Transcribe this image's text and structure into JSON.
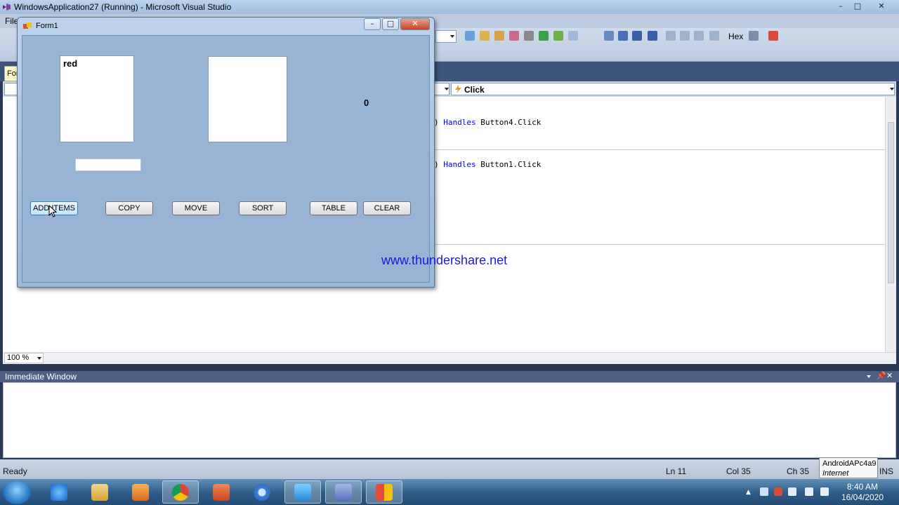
{
  "vs": {
    "title": "WindowsApplication27 (Running) - Microsoft Visual Studio",
    "menu_file": "File",
    "toolbar_hex": "Hex",
    "doc_tab_label": "For",
    "nav_event": "Click",
    "code_lines": [
      {
        "keyword": "Handles",
        "target": "Button4.Click"
      },
      {
        "keyword": "Handles",
        "target": "Button1.Click"
      }
    ],
    "zoom": "100 %",
    "immediate_window_title": "Immediate Window",
    "status": {
      "ready": "Ready",
      "ln": "Ln 11",
      "col": "Col 35",
      "ch": "Ch 35",
      "ins": "INS"
    },
    "tooltip": {
      "network": "AndroidAPc4a9",
      "access": "Internet access"
    },
    "clock": {
      "time": "8:40 AM",
      "date": "16/04/2020"
    }
  },
  "form1": {
    "title": "Form1",
    "listbox1_items": [
      "red"
    ],
    "count_label": "0",
    "textbox_value": "",
    "buttons": {
      "add_items": "ADD ITEMS",
      "copy": "COPY",
      "move": "MOVE",
      "sort": "SORT",
      "table": "TABLE",
      "clear": "CLEAR"
    },
    "watermark": "www.thundershare.net"
  },
  "colors": {
    "form_back": "#98b3d3",
    "watermark": "#1a1ad4",
    "keyword": "#0000ff"
  }
}
